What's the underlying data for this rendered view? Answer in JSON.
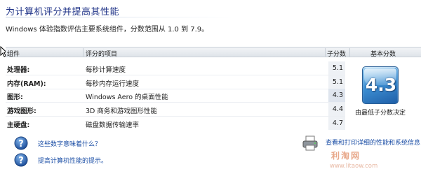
{
  "header": {
    "title": "为计算机评分并提高其性能",
    "subtitle": "Windows 体验指数评估主要系统组件，分数范围从 1.0 到 7.9。"
  },
  "table": {
    "columns": {
      "component": "组件",
      "rated_item": "评分的项目",
      "subscore": "子分数",
      "base_score": "基本分数"
    },
    "rows": [
      {
        "component": "处理器:",
        "description": "每秒计算速度",
        "score": "5.1"
      },
      {
        "component": "内存(RAM):",
        "description": "每秒内存运行速度",
        "score": "5.1"
      },
      {
        "component": "图形:",
        "description": "Windows Aero 的桌面性能",
        "score": "4.3"
      },
      {
        "component": "游戏图形:",
        "description": "3D 商务和游戏图形性能",
        "score": "4.4"
      },
      {
        "component": "主硬盘:",
        "description": "磁盘数据传输速率",
        "score": "4.7"
      }
    ]
  },
  "base_score": {
    "value": "4.3",
    "caption": "由最低子分数决定"
  },
  "help_links": [
    {
      "label": "这些数字意味着什么？",
      "icon": "help-icon"
    },
    {
      "label": "提高计算机性能的提示。",
      "icon": "help-icon"
    }
  ],
  "print_link": {
    "label": "查看和打印详细的性能和系统信息",
    "icon": "printer-icon"
  },
  "watermark": {
    "name": "利淘网",
    "url": "www.litaow.com"
  },
  "colors": {
    "title": "#1e3287",
    "link": "#1a4da5",
    "badge": "#3d8fd3"
  }
}
